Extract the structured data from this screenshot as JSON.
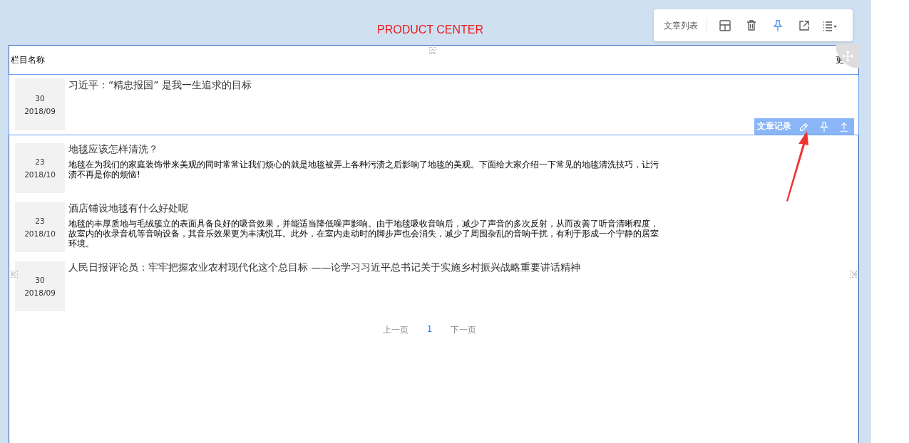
{
  "subtitle": "PRODUCT CENTER",
  "toolbar": {
    "label": "文章列表",
    "icons": [
      {
        "kind": "layout",
        "selected": false
      },
      {
        "kind": "trash",
        "selected": false
      },
      {
        "kind": "pin",
        "selected": true
      },
      {
        "kind": "external",
        "selected": false
      },
      {
        "kind": "list",
        "selected": false
      }
    ]
  },
  "header": {
    "left": "栏目名称",
    "right": "更"
  },
  "row_toolbar": {
    "label": "文章记录"
  },
  "articles": [
    {
      "day": "30",
      "month": "2018/09",
      "title": "习近平：“精忠报国” 是我一生追求的目标",
      "selected": true
    },
    {
      "day": "23",
      "month": "2018/10",
      "title": "地毯应该怎样清洗？",
      "summary": "地毯在为我们的家庭装饰带来美观的同时常常让我们烦心的就是地毯被弄上各种污渍之后影响了地毯的美观。下面给大家介绍一下常见的地毯清洗技巧，让污渍不再是你的烦恼!",
      "selected": false
    },
    {
      "day": "23",
      "month": "2018/10",
      "title": "酒店铺设地毯有什么好处呢",
      "summary": "地毯的丰厚质地与毛绒簇立的表面具备良好的吸音效果，并能适当降低噪声影响。由于地毯吸收音响后，减少了声音的多次反射，从而改善了听音清晰程度，故室内的收录音机等音响设备，其音乐效果更为丰满悦耳。此外，在室内走动时的脚步声也会消失，减少了周围杂乱的音响干扰，有利于形成一个宁静的居室环境。",
      "selected": false
    },
    {
      "day": "30",
      "month": "2018/09",
      "title": "人民日报评论员：牢牢把握农业农村现代化这个总目标 ——论学习习近平总书记关于实施乡村振兴战略重要讲话精神",
      "selected": false
    }
  ],
  "pagination": {
    "prev": "上一页",
    "pages": [
      {
        "label": "1",
        "selected": true
      }
    ],
    "next": "下一页"
  }
}
